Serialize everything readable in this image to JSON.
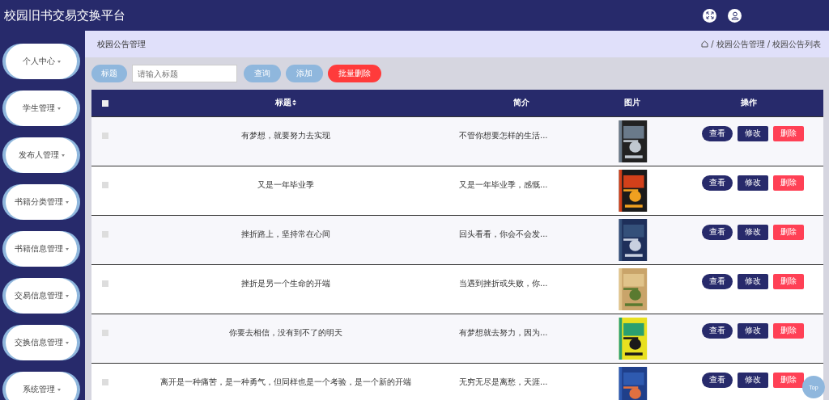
{
  "app_title": "校园旧书交易交换平台",
  "sidebar": {
    "items": [
      {
        "label": "个人中心"
      },
      {
        "label": "学生管理"
      },
      {
        "label": "发布人管理"
      },
      {
        "label": "书籍分类管理"
      },
      {
        "label": "书籍信息管理"
      },
      {
        "label": "交易信息管理"
      },
      {
        "label": "交换信息管理"
      },
      {
        "label": "系统管理"
      }
    ]
  },
  "page_title": "校园公告管理",
  "breadcrumb_separator": "/",
  "breadcrumb": [
    "校园公告管理",
    "校园公告列表"
  ],
  "search": {
    "label": "标题",
    "placeholder": "请输入标题"
  },
  "toolbar_buttons": [
    {
      "label": "查询",
      "kind": "primary"
    },
    {
      "label": "添加",
      "kind": "primary"
    },
    {
      "label": "批量删除",
      "kind": "danger"
    }
  ],
  "table": {
    "all_checked": false,
    "columns": [
      "标题",
      "简介",
      "图片",
      "操作"
    ],
    "rows": [
      {
        "checked": false,
        "title": "有梦想，就要努力去实现",
        "intro": "不管你想要怎样的生活...",
        "actions": [
          "查看",
          "修改",
          "删除"
        ]
      },
      {
        "checked": false,
        "title": "又是一年毕业季",
        "intro": "又是一年毕业季，感慨...",
        "actions": [
          "查看",
          "修改",
          "删除"
        ]
      },
      {
        "checked": false,
        "title": "挫折路上，坚持常在心间",
        "intro": "回头看看，你会不会发...",
        "actions": [
          "查看",
          "修改",
          "删除"
        ]
      },
      {
        "checked": false,
        "title": "挫折是另一个生命的开端",
        "intro": "当遇到挫折或失败，你...",
        "actions": [
          "查看",
          "修改",
          "删除"
        ]
      },
      {
        "checked": false,
        "title": "你要去相信，没有到不了的明天",
        "intro": "有梦想就去努力，因为...",
        "actions": [
          "查看",
          "修改",
          "删除"
        ]
      },
      {
        "checked": false,
        "title": "离开是一种痛苦，是一种勇气，但同样也是一个考验，是一个新的开端",
        "intro": "无穷无尽是离愁，天涯...",
        "actions": [
          "查看",
          "修改",
          "删除"
        ]
      }
    ]
  },
  "top_button": "Top"
}
